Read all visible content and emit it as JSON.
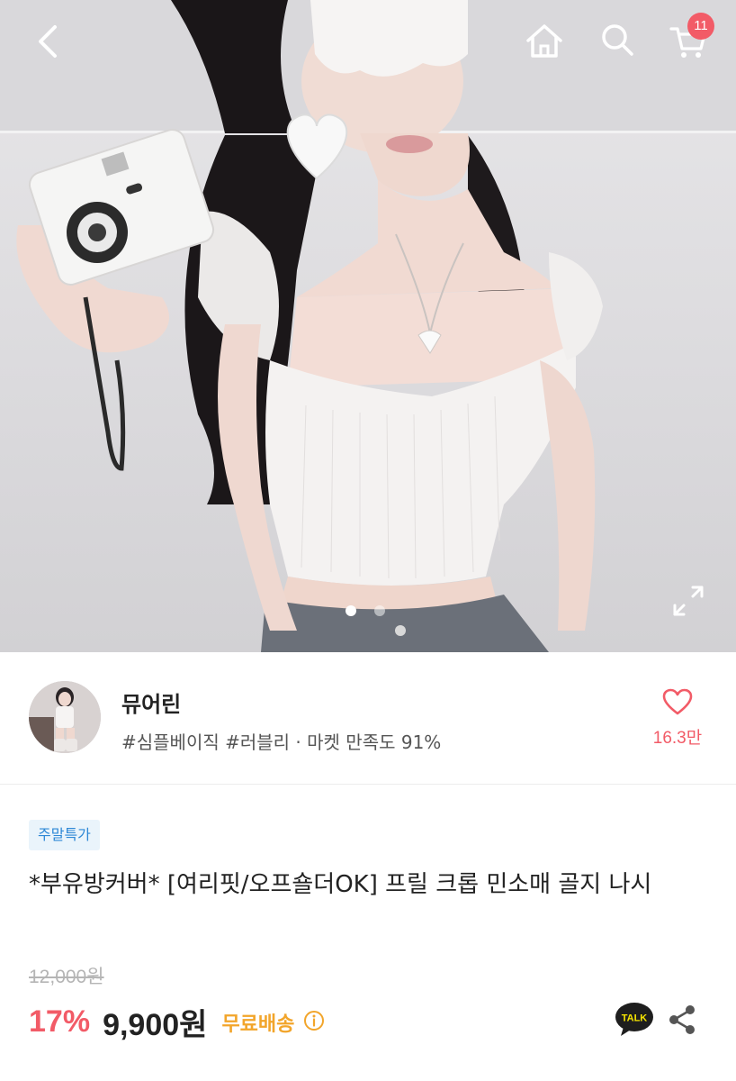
{
  "header": {
    "back_icon": "chevron-left-icon",
    "home_icon": "home-icon",
    "search_icon": "search-icon",
    "cart_icon": "cart-icon",
    "cart_count": "11"
  },
  "gallery": {
    "image_count": 2,
    "active_index": 0,
    "expand_icon": "expand-icon"
  },
  "seller": {
    "name": "뮤어린",
    "tags": "#심플베이직 #러블리 · 마켓 만족도 91%",
    "like_icon": "heart-outline-icon",
    "like_count": "16.3만"
  },
  "product": {
    "badge": "주말특가",
    "title": "*부유방커버* [여리핏/오프숄더OK]  프릴 크롭 민소매 골지 나시",
    "original_price": "12,000원",
    "discount": "17%",
    "price": "9,900원",
    "shipping": "무료배송",
    "shipping_info_icon": "info-icon",
    "talk_label": "TALK",
    "share_icon": "share-icon"
  },
  "colors": {
    "accent_pink": "#f25b67",
    "badge_blue": "#2f88d6",
    "shipping_orange": "#f2a52b"
  }
}
